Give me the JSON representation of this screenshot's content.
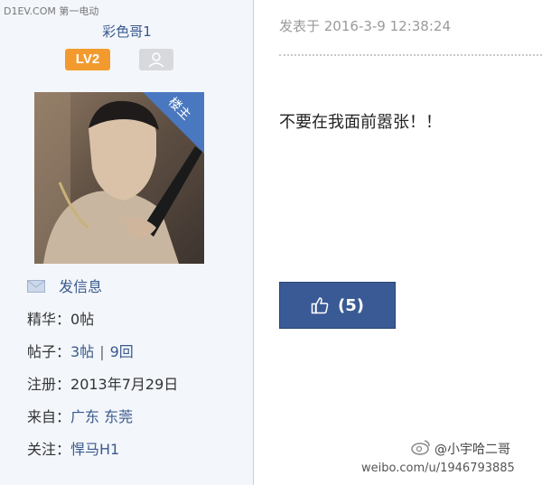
{
  "site": {
    "watermark": "D1EV.COM 第一电动"
  },
  "author": {
    "username": "彩色哥1",
    "level": "LV2",
    "owner_tag": "楼主",
    "send_message_label": "发信息",
    "essence": {
      "label": "精华：",
      "value": "0帖"
    },
    "posts": {
      "label": "帖子：",
      "threads": "3帖",
      "separator": "|",
      "replies": "9回"
    },
    "registered": {
      "label": "注册：",
      "value": "2013年7月29日"
    },
    "location": {
      "label": "来自：",
      "value": "广东 东莞"
    },
    "follows": {
      "label": "关注：",
      "value": "悍马H1"
    }
  },
  "post": {
    "meta": "发表于 2016-3-9 12:38:24",
    "content": "不要在我面前嚣张！！",
    "like_count": "(5)"
  },
  "weibo": {
    "handle": "@小宇哈二哥",
    "url": "weibo.com/u/1946793885"
  },
  "colors": {
    "link": "#3a5a8c",
    "level_badge": "#f29a2e",
    "like_button": "#3a5a95",
    "owner_ribbon": "#4a78c0",
    "sidebar_bg": "#f3f6fb"
  },
  "icons": {
    "user_badge": "user-silhouette-icon",
    "message": "envelope-icon",
    "like": "thumbs-up-icon",
    "weibo": "weibo-logo-icon"
  }
}
